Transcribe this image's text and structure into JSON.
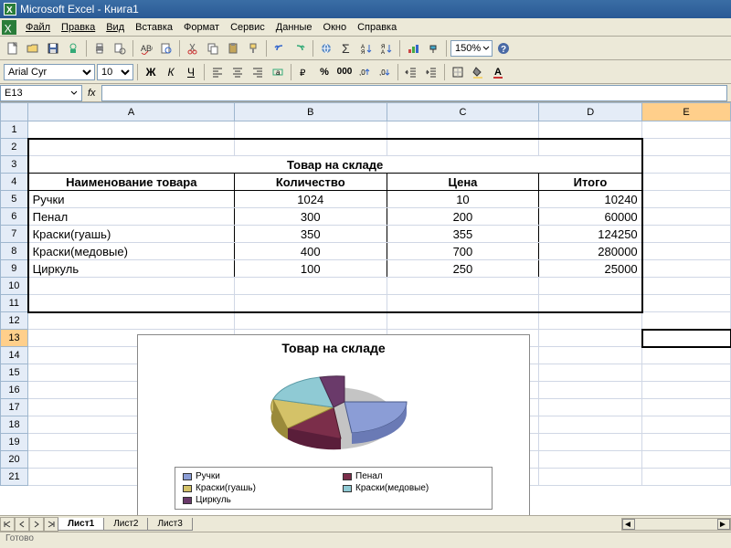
{
  "window": {
    "title": "Microsoft Excel - Книга1"
  },
  "menu": [
    "Файл",
    "Правка",
    "Вид",
    "Вставка",
    "Формат",
    "Сервис",
    "Данные",
    "Окно",
    "Справка"
  ],
  "toolbar": {
    "zoom": "150%"
  },
  "format": {
    "font": "Arial Cyr",
    "size": "10"
  },
  "formula": {
    "cell": "E13",
    "fx": "fx"
  },
  "columns": [
    "A",
    "B",
    "C",
    "D",
    "E"
  ],
  "rows": [
    "1",
    "2",
    "3",
    "4",
    "5",
    "6",
    "7",
    "8",
    "9",
    "10",
    "11",
    "12",
    "13",
    "14",
    "15",
    "16",
    "17",
    "18",
    "19",
    "20",
    "21"
  ],
  "table": {
    "title": "Товар на складе",
    "headers": [
      "Наименование товара",
      "Количество",
      "Цена",
      "Итого"
    ],
    "rows": [
      {
        "name": "Ручки",
        "qty": "1024",
        "price": "10",
        "total": "10240"
      },
      {
        "name": "Пенал",
        "qty": "300",
        "price": "200",
        "total": "60000"
      },
      {
        "name": "Краски(гуашь)",
        "qty": "350",
        "price": "355",
        "total": "124250"
      },
      {
        "name": "Краски(медовые)",
        "qty": "400",
        "price": "700",
        "total": "280000"
      },
      {
        "name": "Циркуль",
        "qty": "100",
        "price": "250",
        "total": "25000"
      }
    ]
  },
  "chart_data": {
    "type": "pie",
    "title": "Товар на складе",
    "categories": [
      "Ручки",
      "Пенал",
      "Краски(гуашь)",
      "Краски(медовые)",
      "Циркуль"
    ],
    "values": [
      1024,
      300,
      350,
      400,
      100
    ],
    "colors": [
      "#8b9dd6",
      "#7b2e4a",
      "#d4c268",
      "#8fcad4",
      "#6a3a6a"
    ]
  },
  "sheets": [
    "Лист1",
    "Лист2",
    "Лист3"
  ],
  "status": "Готово"
}
